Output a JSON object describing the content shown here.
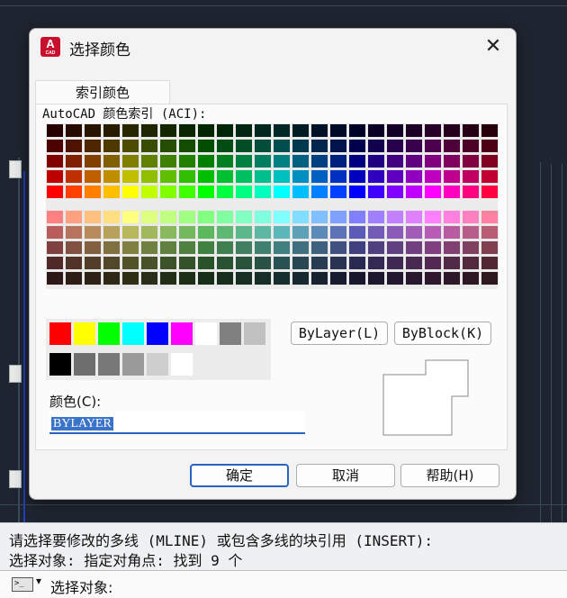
{
  "dialog": {
    "title": "选择颜色",
    "app_icon_letter": "A",
    "app_icon_sub": "CAD",
    "close_glyph": "✕",
    "tab_label": "索引颜色",
    "aci_label": "AutoCAD 颜色索引 (ACI):",
    "bylayer_label": "ByLayer(L)",
    "byblock_label": "ByBlock(K)",
    "color_field_label": "颜色(C):",
    "color_field_value": "BYLAYER",
    "ok_label": "确定",
    "cancel_label": "取消",
    "help_label": "帮助(H)"
  },
  "palette": {
    "top_colors": [
      "#ff0000",
      "#ff4000",
      "#ff8000",
      "#ffbf00",
      "#ffff00",
      "#bfff00",
      "#80ff00",
      "#40ff00",
      "#00ff00",
      "#00ff40",
      "#00ff80",
      "#00ffbf",
      "#00ffff",
      "#00bfff",
      "#0080ff",
      "#0040ff",
      "#0000ff",
      "#4000ff",
      "#8000ff",
      "#bf00ff",
      "#ff00ff",
      "#ff00bf",
      "#ff0080",
      "#ff0040"
    ],
    "standard_row1": [
      "#ff0000",
      "#ffff00",
      "#00ff00",
      "#00ffff",
      "#0000ff",
      "#ff00ff",
      "#ffffff",
      "#808080",
      "#c0c0c0"
    ],
    "standard_row2": [
      "#000000",
      "#6e6e6e",
      "#787878",
      "#9a9a9a",
      "#cecece",
      "#ffffff"
    ],
    "preview_color": "#ffffff"
  },
  "command": {
    "line1": "请选择要修改的多线 (MLINE) 或包含多线的块引用 (INSERT):",
    "line2": "选择对象: 指定对角点: 找到 9 个",
    "prompt": "选择对象:",
    "prompt_icon": ">_",
    "prompt_arrow": "▾"
  }
}
